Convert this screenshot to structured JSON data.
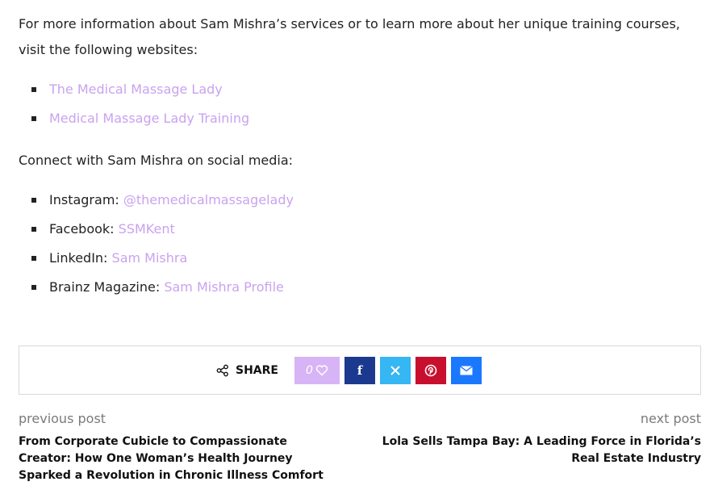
{
  "intro": {
    "text": "For more information about Sam Mishra’s services or to learn more about her unique training courses, visit the following websites:"
  },
  "websites": [
    {
      "label": "The Medical Massage Lady"
    },
    {
      "label": "Medical Massage Lady Training"
    }
  ],
  "social_intro": {
    "text": "Connect with Sam Mishra on social media:"
  },
  "social": [
    {
      "platform": "Instagram:",
      "handle": "@themedicalmassagelady"
    },
    {
      "platform": "Facebook:",
      "handle": "SSMKent"
    },
    {
      "platform": "LinkedIn:",
      "handle": "Sam Mishra"
    },
    {
      "platform": "Brainz Magazine:",
      "handle": "Sam Mishra Profile"
    }
  ],
  "share": {
    "label": "SHARE",
    "like_count": "0",
    "buttons": {
      "like": "heart-icon",
      "facebook": "facebook-icon",
      "x": "x-icon",
      "pinterest": "pinterest-icon",
      "email": "email-icon"
    }
  },
  "navigation": {
    "previous_label": "previous post",
    "previous_title": "From Corporate Cubicle to Compassionate Creator: How One Woman’s Health Journey Sparked a Revolution in Chronic Illness Comfort",
    "next_label": "next post",
    "next_title": "Lola Sells Tampa Bay: A Leading Force in Florida’s Real Estate Industry"
  },
  "colors": {
    "link": "#c9a3f0",
    "like": "#d7b4f5",
    "facebook": "#1b3a8f",
    "x": "#36b6f2",
    "pinterest": "#c8102e",
    "email": "#1a78ff"
  }
}
